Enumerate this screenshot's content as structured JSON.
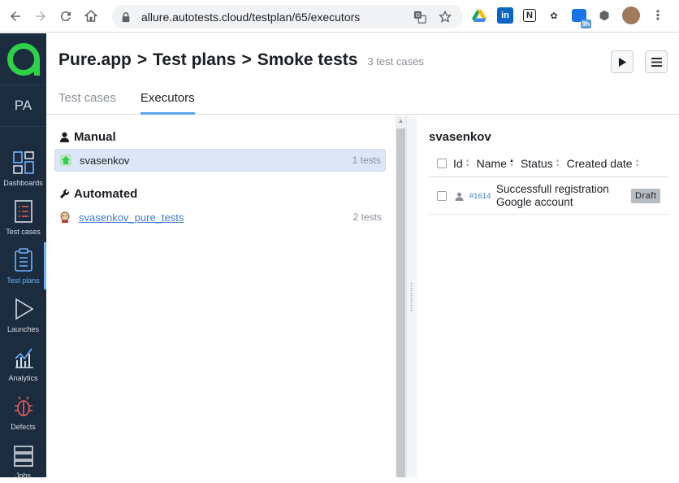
{
  "browser": {
    "url": "allure.autotests.cloud/testplan/65/executors",
    "ext_badge": "9h"
  },
  "sidebar": {
    "project": "PA",
    "items": [
      {
        "label": "Dashboards"
      },
      {
        "label": "Test cases"
      },
      {
        "label": "Test plans"
      },
      {
        "label": "Launches"
      },
      {
        "label": "Analytics"
      },
      {
        "label": "Defects"
      },
      {
        "label": "Jobs"
      }
    ],
    "colors": {
      "background": "#1a2c3e",
      "accent": "#6fb4ff",
      "logo": "#2ed148"
    }
  },
  "header": {
    "crumbs": [
      "Pure.app",
      "Test plans",
      "Smoke tests"
    ],
    "separator": ">",
    "count": "3 test cases"
  },
  "tabs": [
    {
      "label": "Test cases"
    },
    {
      "label": "Executors"
    }
  ],
  "executors": {
    "manual_title": "Manual",
    "manual": [
      {
        "name": "svasenkov",
        "count": "1 tests"
      }
    ],
    "automated_title": "Automated",
    "automated": [
      {
        "name": "svasenkov_pure_tests",
        "count": "2 tests"
      }
    ]
  },
  "detail": {
    "title": "svasenkov",
    "columns": [
      "Id",
      "Name",
      "Status",
      "Created date"
    ],
    "rows": [
      {
        "id": "#1614",
        "name_line1": "Successfull registration",
        "name_line2": "Google account",
        "status": "Draft"
      }
    ]
  }
}
